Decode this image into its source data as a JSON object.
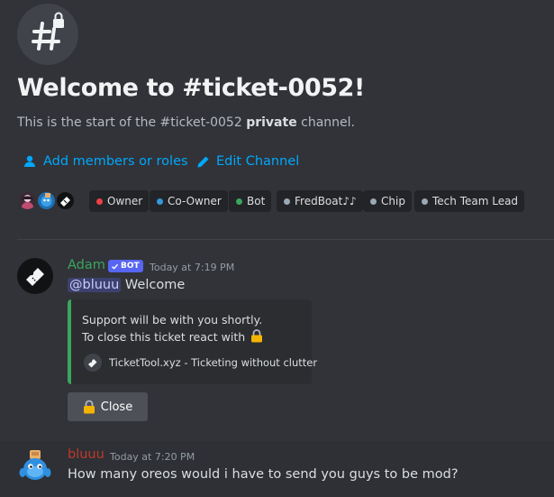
{
  "channel": {
    "title": "Welcome to #ticket-0052!",
    "subtitle_prefix": "This is the start of the #ticket-0052",
    "subtitle_bold": "private",
    "subtitle_suffix": "channel.",
    "icon": "hashtag-lock-icon"
  },
  "actions": {
    "add_members": "Add members or roles",
    "edit_channel": "Edit Channel"
  },
  "roles": [
    {
      "label": "Owner",
      "color": "#ed4245"
    },
    {
      "label": "Co-Owner",
      "color": "#3498db"
    },
    {
      "label": "Bot",
      "color": "#3ba55c"
    },
    {
      "label": "FredBoat♪♪",
      "color": "#99aab5"
    },
    {
      "label": "Chip",
      "color": "#99aab5"
    },
    {
      "label": "Tech Team Lead",
      "color": "#99aab5"
    }
  ],
  "messages": [
    {
      "author": "Adam",
      "author_color": "#3ba55c",
      "bot_tag": "BOT",
      "time": "Today at 7:19 PM",
      "mention": "@bluuu",
      "text": "Welcome",
      "embed": {
        "line1": "Support will be with you shortly.",
        "line2": "To close this ticket react with",
        "footer": "TicketTool.xyz - Ticketing without clutter",
        "accent": "#3ba55c"
      },
      "button": "Close"
    },
    {
      "author": "bluuu",
      "author_color": "#c0392b",
      "time": "Today at 7:20 PM",
      "text": "How many oreos would i have to send you guys to be mod?"
    }
  ]
}
